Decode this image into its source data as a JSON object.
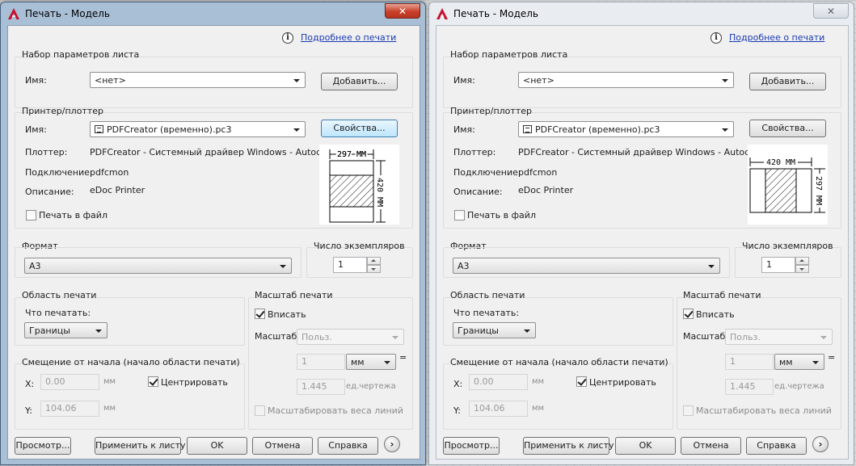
{
  "dialog": {
    "title": "Печать - Модель",
    "close_icon": "close-icon",
    "app_icon": "autocad-icon",
    "info_icon": "info-icon",
    "help_link": "Подробнее о печати"
  },
  "page_setup": {
    "group_label": "Набор параметров листа",
    "name_label": "Имя:",
    "name_value": "<нет>",
    "add_button": "Добавить..."
  },
  "printer": {
    "group_label": "Принтер/плоттер",
    "name_label": "Имя:",
    "name_value": "PDFCreator (временно).pc3",
    "properties_button": "Свойства...",
    "plotter_label": "Плоттер:",
    "plotter_value": "PDFCreator - Системный драйвер Windows - Autod...",
    "connection_label": "Подключение:",
    "connection_value": "pdfcmon",
    "description_label": "Описание:",
    "description_value": "eDoc Printer",
    "print_to_file_label": "Печать в файл",
    "print_to_file_checked": false
  },
  "preview_left": {
    "width_label": "297 ММ",
    "height_label": "420 ММ"
  },
  "preview_right": {
    "width_label": "420 ММ",
    "height_label": "297 ММ"
  },
  "format": {
    "group_label": "Формат",
    "value": "A3"
  },
  "copies": {
    "label": "Число экземпляров",
    "value": "1"
  },
  "print_area": {
    "group_label": "Область печати",
    "what_label": "Что печатать:",
    "what_value": "Границы"
  },
  "offset": {
    "group_label": "Смещение от начала (начало области печати)",
    "x_label": "X:",
    "x_value": "0.00",
    "x_unit": "мм",
    "y_label": "Y:",
    "y_value": "104.06",
    "y_unit": "мм",
    "center_label": "Центрировать",
    "center_checked": true
  },
  "scale": {
    "group_label": "Масштаб печати",
    "fit_label": "Вписать",
    "fit_checked": true,
    "scale_label": "Масштаб:",
    "scale_value": "Польз.",
    "value1": "1",
    "unit_value": "мм",
    "equals": "=",
    "value2": "1.445",
    "unit2": "ед.чертежа",
    "lineweights_label": "Масштабировать веса линий",
    "lineweights_checked": false
  },
  "buttons": {
    "preview": "Просмотр...",
    "apply": "Применить к листу",
    "ok": "OK",
    "cancel": "Отмена",
    "help": "Справка",
    "more_icon": "chevron-right-icon"
  },
  "colors": {
    "active_frame": "#a9bfd6",
    "inactive_frame": "#e9edf2",
    "link": "#1a3ab3",
    "close_active": "#c8402a"
  }
}
